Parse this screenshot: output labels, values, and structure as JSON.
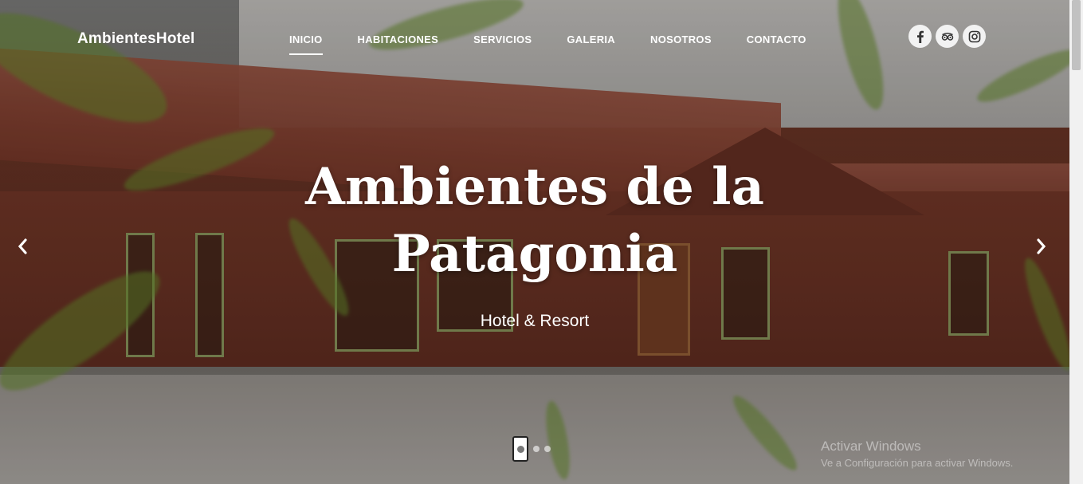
{
  "brand": "AmbientesHotel",
  "nav": {
    "items": [
      {
        "label": "INICIO",
        "active": true
      },
      {
        "label": "HABITACIONES",
        "active": false
      },
      {
        "label": "SERVICIOS",
        "active": false
      },
      {
        "label": "GALERIA",
        "active": false
      },
      {
        "label": "NOSOTROS",
        "active": false
      },
      {
        "label": "CONTACTO",
        "active": false
      }
    ]
  },
  "social": [
    {
      "icon": "facebook-icon",
      "glyph": "f"
    },
    {
      "icon": "tripadvisor-icon",
      "glyph": "oo"
    },
    {
      "icon": "instagram-icon",
      "glyph": ""
    }
  ],
  "hero": {
    "title_line1": "Ambientes de la",
    "title_line2": "Patagonia",
    "subtitle": "Hotel & Resort"
  },
  "carousel": {
    "slides": 3,
    "active_index": 0,
    "prev_icon": "chevron-left-icon",
    "next_icon": "chevron-right-icon"
  },
  "watermark": {
    "line1": "Activar Windows",
    "line2": "Ve a Configuración para activar Windows."
  }
}
